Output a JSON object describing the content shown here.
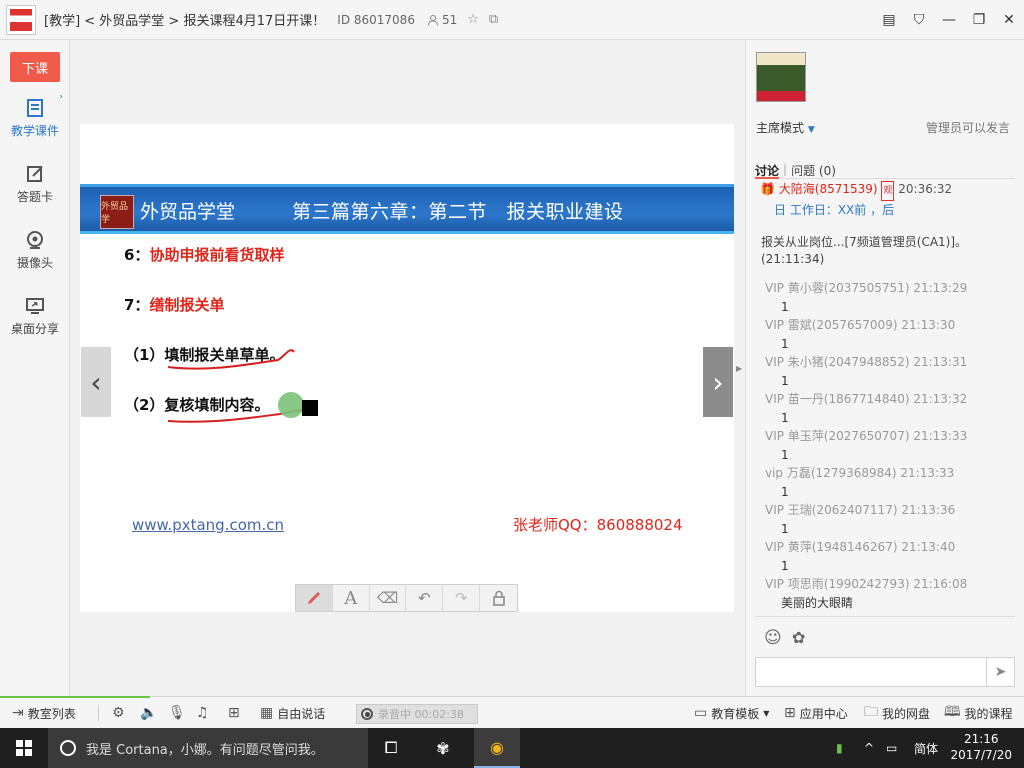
{
  "window": {
    "title": "[教学] < 外贸品学堂 > 报关课程4月17日开课！",
    "room_id": "ID 86017086",
    "member_count": "51"
  },
  "leftnav": {
    "end_class_label": "下课",
    "items": [
      {
        "label": "教学课件",
        "icon": "courseware-icon"
      },
      {
        "label": "答题卡",
        "icon": "answer-card-icon"
      },
      {
        "label": "摄像头",
        "icon": "camera-icon"
      },
      {
        "label": "桌面分享",
        "icon": "screen-share-icon"
      }
    ]
  },
  "slide": {
    "logo_text": "外贸品学",
    "brand": "外贸品学堂",
    "chapter": "第三篇第六章：第二节　报关职业建设",
    "line6_num": "6：",
    "line6_text": "协助申报前看货取样",
    "line7_num": "7：",
    "line7_text": "缮制报关单",
    "item1": "（1）填制报关单草单。",
    "item2": "（2）复核填制内容。",
    "url": "www.pxtang.com.cn",
    "contact": "张老师QQ：860888024"
  },
  "toolbar": {
    "tools": [
      "pen-tool",
      "text-tool",
      "eraser-tool",
      "undo-tool",
      "redo-tool",
      "lock-tool"
    ],
    "text_glyph": "A"
  },
  "chat": {
    "mode": "主席模式",
    "admin_note": "管理员可以发言",
    "tab_discussion": "讨论",
    "tab_questions": "问题",
    "questions_count": "(0)",
    "pinned_name": "大陪海(8571539)",
    "pinned_badge": "观",
    "pinned_time": "20:36:32",
    "pinned_notice": "日 工作日：XX前 ，后",
    "clipped_text": "报关从业岗位...[7频道管理员(CA1)]。(21:11:34)",
    "messages": [
      {
        "header": "VIP 黄小蓉(2037505751) 21:13:29",
        "body": "1"
      },
      {
        "header": "VIP 雷斌(2057657009) 21:13:30",
        "body": "1"
      },
      {
        "header": "VIP 朱小猪(2047948852) 21:13:31",
        "body": "1"
      },
      {
        "header": "VIP 苗一丹(1867714840) 21:13:32",
        "body": "1"
      },
      {
        "header": "VIP 单玉萍(2027650707) 21:13:33",
        "body": "1"
      },
      {
        "header": "vip 万磊(1279368984) 21:13:33",
        "body": "1"
      },
      {
        "header": "VIP 王瑞(2062407117) 21:13:36",
        "body": "1"
      },
      {
        "header": "VIP 黄萍(1948146267) 21:13:40",
        "body": "1"
      },
      {
        "header": "VIP 项思雨(1990242793) 21:16:08",
        "body": "美丽的大眼睛"
      }
    ],
    "input_value": ""
  },
  "bottombar": {
    "classroom_list": "教室列表",
    "free_talk": "自由说话",
    "recording": "录音中 00:02:38",
    "edu_template": "教育模板",
    "app_center": "应用中心",
    "my_disk": "我的网盘",
    "my_courses": "我的课程"
  },
  "taskbar": {
    "cortana_placeholder": "我是 Cortana，小娜。有问题尽管问我。",
    "ime": "简体",
    "time": "21:16",
    "date": "2017/7/20"
  },
  "colors": {
    "accent_red": "#e0261b",
    "link_blue": "#2a78c7",
    "end_class_bg": "#f05a4a"
  }
}
